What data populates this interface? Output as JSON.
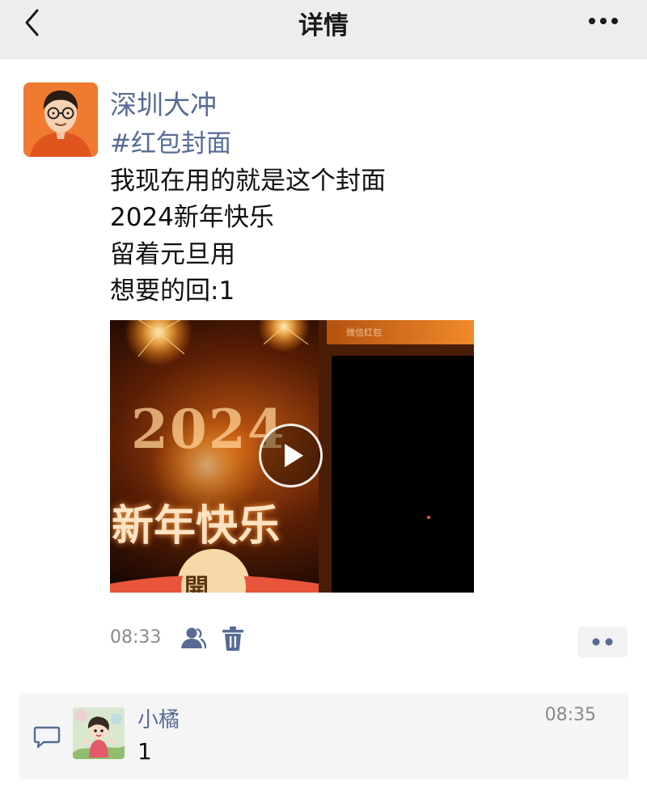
{
  "header": {
    "title": "详情"
  },
  "post": {
    "author": "深圳大冲",
    "hashtag": "#红包封面",
    "lines": [
      "我现在用的就是这个封面",
      "2024新年快乐",
      "留着元旦用",
      "想要的回:1"
    ],
    "time": "08:33",
    "video": {
      "year_text": "2024",
      "greeting_text": "新年快乐",
      "open_glyph": "開",
      "screen_title": "微信红包"
    }
  },
  "comment": {
    "author": "小橘",
    "text": "1",
    "time": "08:35"
  },
  "icons": {
    "back": "chevron-left-icon",
    "more": "more-icon",
    "play": "play-icon",
    "visibility": "people-icon",
    "delete": "trash-icon",
    "comment": "comment-bubble-icon"
  },
  "colors": {
    "link": "#576b95",
    "header_bg": "#ededed",
    "comment_bg": "#f5f5f5",
    "accent": "#f07a2f"
  }
}
